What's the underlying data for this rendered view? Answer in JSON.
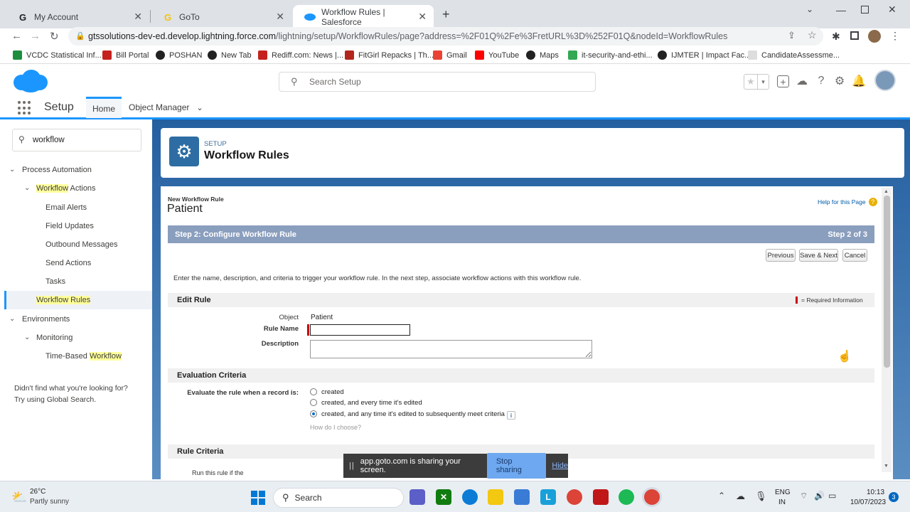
{
  "browser": {
    "tabs": [
      {
        "title": "My Account",
        "favicon": "G"
      },
      {
        "title": "GoTo",
        "favicon": "G"
      },
      {
        "title": "Workflow Rules | Salesforce",
        "favicon": "cloud"
      }
    ],
    "url_host": "gtssolutions-dev-ed.develop.lightning.force.com",
    "url_path": "/lightning/setup/WorkflowRules/page?address=%2F01Q%2Fe%3FretURL%3D%252F01Q&nodeId=WorkflowRules",
    "bookmarks": [
      "VCDC Statistical Inf...",
      "Bill Portal",
      "POSHAN",
      "New Tab",
      "Rediff.com: News |...",
      "FitGirl Repacks | Th...",
      "Gmail",
      "YouTube",
      "Maps",
      "it-security-and-ethi...",
      "IJMTER | Impact Fac...",
      "CandidateAssessme..."
    ]
  },
  "header": {
    "search_placeholder": "Search Setup",
    "app_name": "Setup",
    "nav_tabs": [
      "Home",
      "Object Manager"
    ]
  },
  "sidebar": {
    "quick_find": "workflow",
    "process_automation": "Process Automation",
    "workflow_actions_prefix": "Workflow",
    "workflow_actions_suffix": " Actions",
    "items": [
      "Email Alerts",
      "Field Updates",
      "Outbound Messages",
      "Send Actions",
      "Tasks"
    ],
    "workflow_rules": "Workflow Rules",
    "environments": "Environments",
    "monitoring": "Monitoring",
    "time_based_prefix": "Time-Based ",
    "time_based_hl": "Workflow",
    "help_line1": "Didn't find what you're looking for?",
    "help_line2": "Try using Global Search."
  },
  "page_header": {
    "eyebrow": "SETUP",
    "title": "Workflow Rules"
  },
  "form": {
    "subtitle": "New Workflow Rule",
    "object_title": "Patient",
    "help_link": "Help for this Page",
    "step_title": "Step 2: Configure Workflow Rule",
    "step_count": "Step 2 of 3",
    "buttons": {
      "previous": "Previous",
      "save_next": "Save & Next",
      "cancel": "Cancel"
    },
    "intro": "Enter the name, description, and criteria to trigger your workflow rule. In the next step, associate workflow actions with this workflow rule.",
    "edit_rule": "Edit Rule",
    "required_info": "= Required Information",
    "object_label": "Object",
    "object_value": "Patient",
    "rule_name_label": "Rule Name",
    "rule_name_value": "",
    "description_label": "Description",
    "description_value": "",
    "evaluation_criteria": "Evaluation Criteria",
    "evaluate_label": "Evaluate the rule when a record is:",
    "options": [
      {
        "label": "created",
        "selected": false
      },
      {
        "label": "created, and every time it's edited",
        "selected": false
      },
      {
        "label": "created, and any time it's edited to subsequently meet criteria",
        "selected": true
      }
    ],
    "how_choose": "How do I choose?",
    "rule_criteria": "Rule Criteria",
    "run_rule_partial": "Run this rule if the"
  },
  "sharing": {
    "message": "app.goto.com is sharing your screen.",
    "stop": "Stop sharing",
    "hide": "Hide"
  },
  "taskbar": {
    "temp": "26°C",
    "weather": "Partly sunny",
    "search": "Search",
    "lang1": "ENG",
    "lang2": "IN",
    "time": "10:13",
    "date": "10/07/2023",
    "notif_count": "3"
  },
  "colors": {
    "sf_blue": "#1b96ff",
    "step_bar": "#8a9ebe",
    "share_button": "#6ea8f0"
  }
}
